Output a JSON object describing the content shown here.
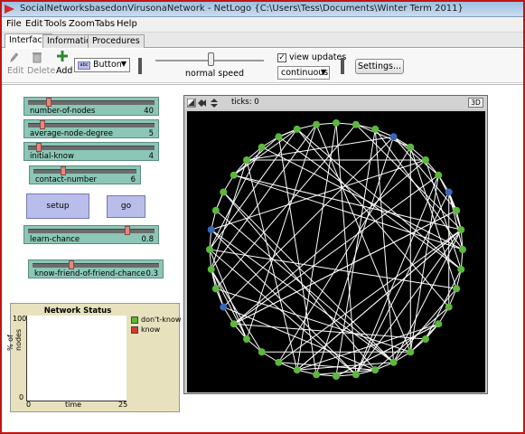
{
  "window": {
    "title": "SocialNetworksbasedonVirusonaNetwork - NetLogo {C:\\Users\\Tess\\Documents\\Winter Term 2011}"
  },
  "menu": [
    "File",
    "Edit",
    "Tools",
    "Zoom",
    "Tabs",
    "Help"
  ],
  "tabs": [
    "Interface",
    "Information",
    "Procedures"
  ],
  "toolbar": {
    "edit": "Edit",
    "delete": "Delete",
    "add": "Add",
    "widget_type": "Button",
    "speed_label": "normal speed",
    "view_updates": "view updates",
    "update_mode": "continuous",
    "settings": "Settings..."
  },
  "sliders": [
    {
      "name": "number-of-nodes",
      "value": "40",
      "level": 0.15
    },
    {
      "name": "average-node-degree",
      "value": "5",
      "level": 0.1
    },
    {
      "name": "initial-know",
      "value": "4",
      "level": 0.07
    },
    {
      "name": "contact-number",
      "value": "6",
      "level": 0.28
    },
    {
      "name": "learn-chance",
      "value": "0.8",
      "level": 0.8
    },
    {
      "name": "know-friend-of-friend-chance",
      "value": "0.3",
      "level": 0.3
    }
  ],
  "buttons": {
    "setup": "setup",
    "go": "go"
  },
  "plot": {
    "title": "Network Status",
    "ylabel": "% of nodes",
    "xlabel": "time",
    "ymax": "100",
    "ymin": "0",
    "xmin": "0",
    "xmax": "25",
    "legend": [
      {
        "label": "don't-know",
        "color": "#5cb83a"
      },
      {
        "label": "know",
        "color": "#d63a2e"
      }
    ]
  },
  "view": {
    "ticks_label": "ticks: 0",
    "btn3d": "3D"
  },
  "colors": {
    "green_node": "#5cb83a",
    "blue_node": "#3a68b8",
    "link": "#ffffff"
  }
}
